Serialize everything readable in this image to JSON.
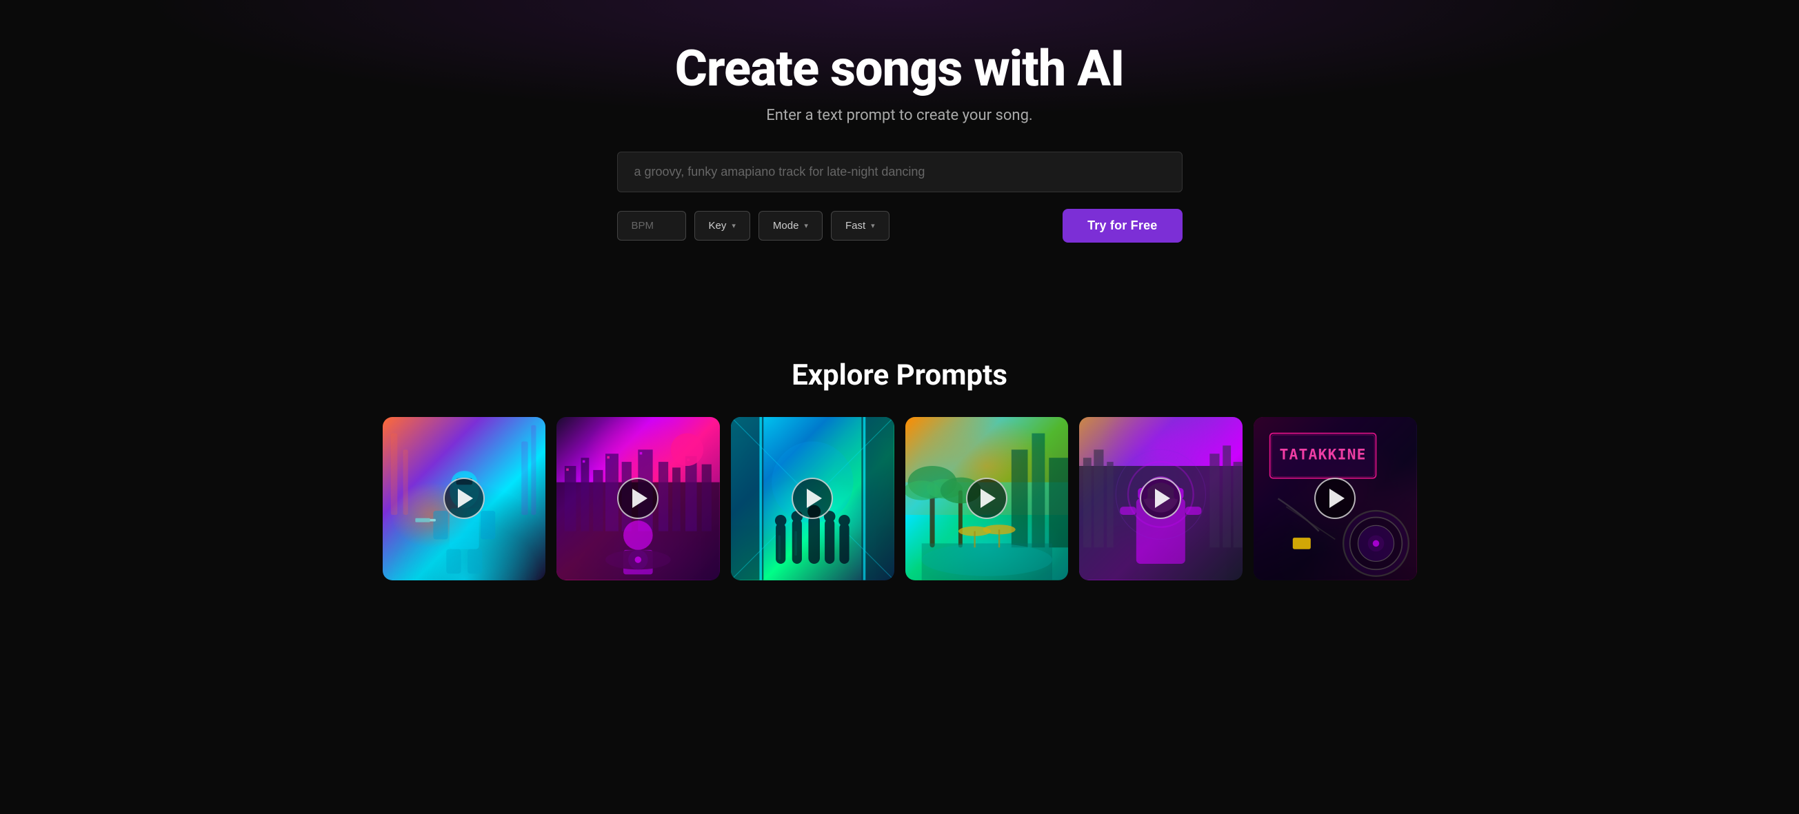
{
  "hero": {
    "title": "Create songs with AI",
    "subtitle": "Enter a text prompt to create your song.",
    "prompt_placeholder": "a groovy, funky amapiano track for late-night dancing",
    "bpm_placeholder": "BPM",
    "key_label": "Key",
    "mode_label": "Mode",
    "speed_label": "Fast",
    "try_free_label": "Try for Free"
  },
  "explore": {
    "title": "Explore Prompts",
    "cards": [
      {
        "id": "card-1",
        "alt": "Futuristic soldier in neon city"
      },
      {
        "id": "card-2",
        "alt": "DJ with neon city skyline and pink moon"
      },
      {
        "id": "card-3",
        "alt": "Band silhouette in cyan corridor"
      },
      {
        "id": "card-4",
        "alt": "Tropical neon city with palm trees"
      },
      {
        "id": "card-5",
        "alt": "DJ with headphones in moody purple light"
      },
      {
        "id": "card-6",
        "alt": "Neon sign TATAKKINE with speaker"
      }
    ]
  },
  "icons": {
    "chevron_down": "▾",
    "play": "▶"
  }
}
